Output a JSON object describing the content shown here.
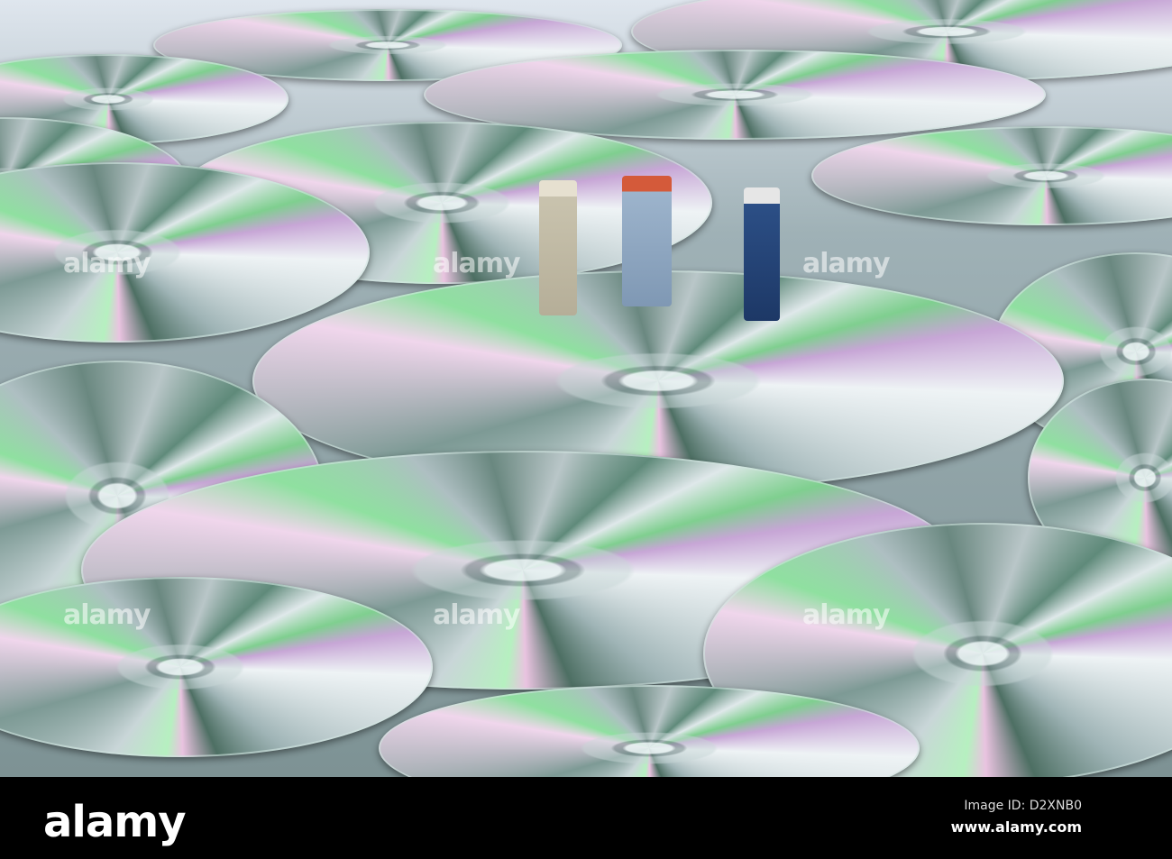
{
  "watermark": {
    "text": "alamy"
  },
  "footer": {
    "logo": "alamy",
    "image_id": "Image ID: D2XNB0",
    "url": "www.alamy.com"
  }
}
